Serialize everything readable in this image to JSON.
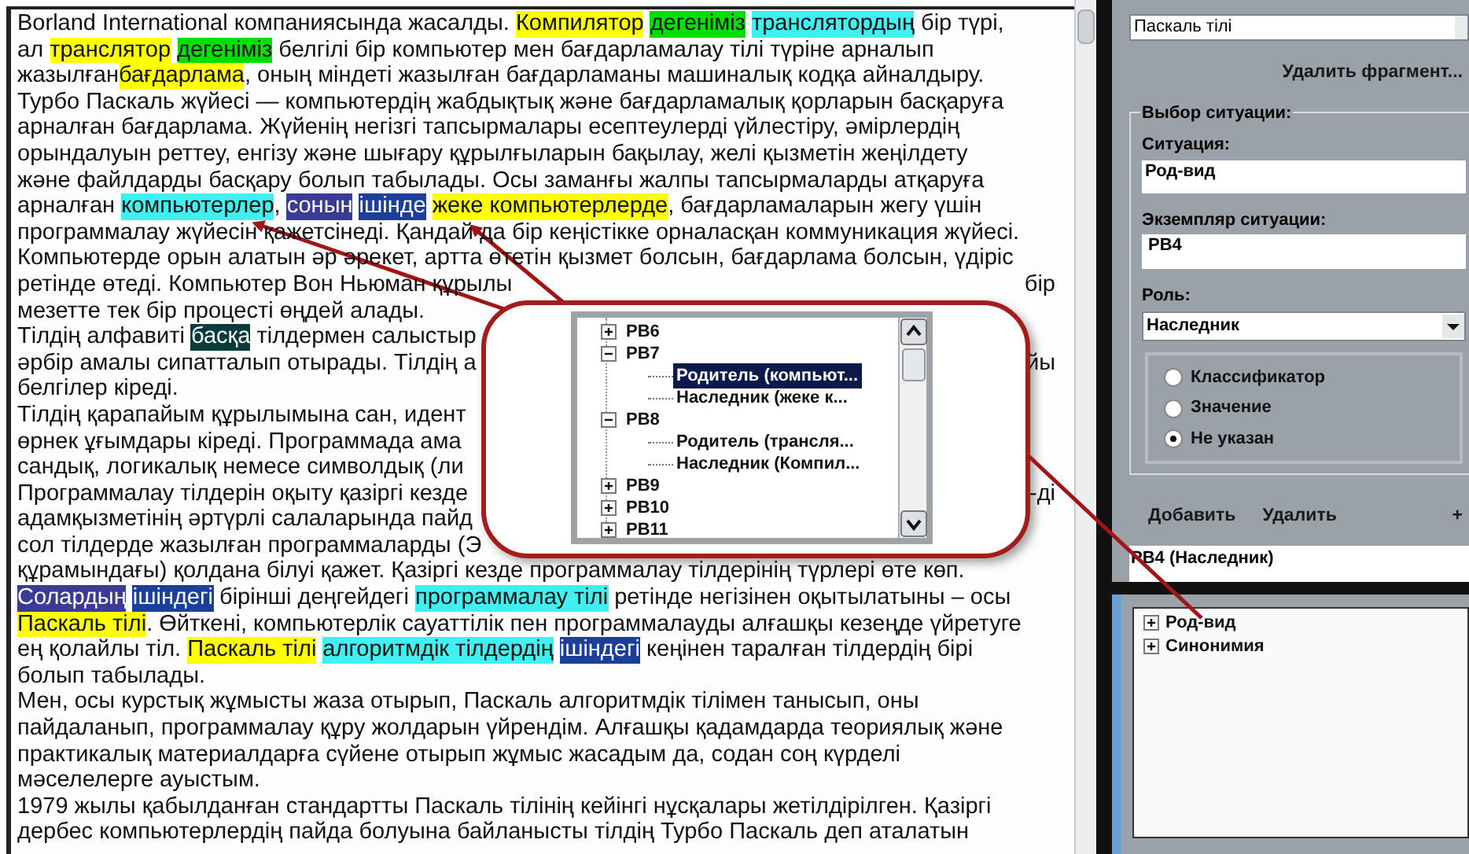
{
  "document": {
    "lines": [
      {
        "segments": [
          {
            "text": "Borland International компаниясында жасалды. "
          },
          {
            "text": "Компилятор",
            "color": "#ffff00"
          },
          {
            "text": "дегеніміз",
            "color": "#00e000"
          },
          {
            "text": "транслятордың",
            "color": "#40f0f0"
          },
          {
            "text": " бір түрі,"
          }
        ]
      },
      {
        "segments": [
          {
            "text": "ал "
          },
          {
            "text": "транслятор",
            "color": "#ffff00"
          },
          {
            "text": "дегеніміз",
            "color": "#00e000"
          },
          {
            "text": " белгілі бір компьютер мен бағдарламалау тілі түріне арналып"
          }
        ]
      },
      {
        "segments": [
          {
            "text": "жазылған"
          },
          {
            "text": "бағдарлама",
            "color": "#ffff00"
          },
          {
            "text": ", оның міндеті жазылған бағдарламаны машиналық кодқа айналдыру."
          }
        ]
      },
      {
        "segments": [
          {
            "text": "Турбо Паскаль жүйесі — компьютердің жабдықтық және бағдарламалық қорларын басқаруға"
          }
        ]
      },
      {
        "segments": [
          {
            "text": "арналған бағдарлама. Жүйенің негізгі тапсырмалары есептеулерді үйлестіру, әмірлердің"
          }
        ]
      },
      {
        "segments": [
          {
            "text": "орындалуын реттеу, енгізу және шығару құрылғыларын бақылау, желі қызметін жеңілдету"
          }
        ]
      },
      {
        "segments": [
          {
            "text": "және файлдарды басқару болып табылады. Осы заманғы жалпы тапсырмаларды атқаруға"
          }
        ]
      },
      {
        "segments": [
          {
            "text": "арналған "
          },
          {
            "text": "компьютерлер",
            "color": "#40f0f0"
          },
          {
            "text": ", "
          },
          {
            "text": "сонын",
            "color": "#3b3b96"
          },
          {
            "text": "ішінде",
            "color": "#1c3f9a"
          },
          {
            "text": "жеке компьютерлерде",
            "color": "#ffff00"
          },
          {
            "text": ", бағдарламаларын жегу үшін"
          }
        ]
      },
      {
        "segments": [
          {
            "text": "программалау жүйесін қажетсінеді. Қандай да бір кеңістікке орналасқан коммуникация жүйесі."
          }
        ]
      },
      {
        "segments": [
          {
            "text": "Компьютерде орын алатын әр әрекет, артта өтетін қызмет болсын, бағдарлама болсын, үдіріс"
          }
        ]
      },
      {
        "segments": [
          {
            "text": "ретінде өтеді. Компьютер Вон Ньюман құрылы"
          }
        ],
        "right": [
          {
            "text": "бір"
          }
        ]
      },
      {
        "segments": [
          {
            "text": "мезетте тек бір процесті өңдей алады."
          }
        ]
      },
      {
        "segments": [
          {
            "text": "Тілдің алфавиті "
          },
          {
            "text": "басқа",
            "color": "#0b3b3b"
          },
          {
            "text": " тілдермен салыстыр"
          }
        ]
      },
      {
        "segments": [
          {
            "text": "әрбір амалы сипатталып отырады. Тілдің а"
          }
        ],
        "right": [
          {
            "text": "йы"
          }
        ]
      },
      {
        "segments": [
          {
            "text": "белгілер кіреді."
          }
        ]
      },
      {
        "segments": [
          {
            "text": "Тілдің қарапайым құрылымына сан, идент"
          }
        ]
      },
      {
        "segments": [
          {
            "text": "өрнек ұғымдары кіреді. Программада ама"
          }
        ]
      },
      {
        "segments": [
          {
            "text": "сандық, логикалық немесе символдық (ли"
          }
        ]
      },
      {
        "segments": [
          {
            "text": "Программалау тілдерін оқыту қазіргі кезде"
          }
        ],
        "right": [
          {
            "text": "-ді"
          }
        ]
      },
      {
        "segments": [
          {
            "text": "адамқызметінің әртүрлі салаларында пайд"
          }
        ]
      },
      {
        "segments": [
          {
            "text": "сол тілдерде жазылған программаларды (Э"
          }
        ]
      },
      {
        "segments": [
          {
            "text": "құрамындағы) қолдана білуі қажет. Қазіргі кезде программалау тілдерінің түрлері өте көп."
          }
        ]
      },
      {
        "segments": [
          {
            "text": "Солардың",
            "color": "#3b3b96"
          },
          {
            "text": "ішіндегі",
            "color": "#1c3f9a"
          },
          {
            "text": " бірінші деңгейдегі "
          },
          {
            "text": "программалау тілі",
            "color": "#40f0f0"
          },
          {
            "text": " ретінде негізінен оқытылатыны – осы"
          }
        ]
      },
      {
        "segments": [
          {
            "text": "Паскаль тілі",
            "color": "#ffff00"
          },
          {
            "text": ". Өйткені, компьютерлік сауаттілік пен программалауды алғашқы кезеңде үйретуге"
          }
        ]
      },
      {
        "segments": [
          {
            "text": "ең қолайлы тіл. "
          },
          {
            "text": "Паскаль тілі",
            "color": "#ffff00"
          },
          {
            "text": "алгоритмдік тілдердің",
            "color": "#40f0f0"
          },
          {
            "text": "ішіндегі",
            "color": "#1c3f9a"
          },
          {
            "text": " кеңінен таралған тілдердің бірі"
          }
        ]
      },
      {
        "segments": [
          {
            "text": "болып табылады."
          }
        ]
      },
      {
        "segments": [
          {
            "text": "Мен, осы курстық жұмысты жаза отырып, Паскаль алгоритмдік тілімен танысып, оны"
          }
        ]
      },
      {
        "segments": [
          {
            "text": "пайдаланып, программалау құру жолдарын үйрендім. Алғашқы қадамдарда теориялық және"
          }
        ]
      },
      {
        "segments": [
          {
            "text": "практикалық материалдарға сүйене отырып жұмыс жасадым да, содан соң күрделі"
          }
        ]
      },
      {
        "segments": [
          {
            "text": "мәселелерге ауыстым."
          }
        ]
      },
      {
        "segments": [
          {
            "text": "1979 жылы қабылданған стандартты Паскаль тілінің кейінгі нұсқалары жетілдірілген. Қазіргі"
          }
        ]
      },
      {
        "segments": [
          {
            "text": "дербес компьютерлердің пайда болуына байланысты тілдің Турбо Паскаль деп аталатын"
          }
        ]
      }
    ]
  },
  "callout_tree": [
    {
      "label": "РВ6",
      "expanded": false,
      "selected": false
    },
    {
      "label": "РВ7",
      "expanded": true,
      "selected": false,
      "children": [
        {
          "label": "Родитель (компьют...",
          "selected": true
        },
        {
          "label": "Наследник (жеке к...",
          "selected": false
        }
      ]
    },
    {
      "label": "РВ8",
      "expanded": true,
      "selected": false,
      "children": [
        {
          "label": "Родитель (трансля...",
          "selected": false
        },
        {
          "label": "Наследник (Компил...",
          "selected": false
        }
      ]
    },
    {
      "label": "РВ9",
      "expanded": false,
      "selected": false
    },
    {
      "label": "РВ10",
      "expanded": false,
      "selected": false
    },
    {
      "label": "РВ11",
      "expanded": false,
      "selected": false
    }
  ],
  "fragment_field": {
    "value": "Паскаль тілі"
  },
  "delete_fragment_button": "Удалить фрагмент...",
  "situation_group": {
    "title": "Выбор ситуации:",
    "situation_label": "Ситуация:",
    "situation_value": "Род-вид",
    "instance_label": "Экземпляр ситуации:",
    "instance_value": "РВ4",
    "role_label": "Роль:",
    "role_value": "Наследник",
    "options": [
      {
        "label": "Классификатор",
        "selected": false
      },
      {
        "label": "Значение",
        "selected": false
      },
      {
        "label": "Не указан",
        "selected": true
      }
    ]
  },
  "toolbar": [
    "Добавить",
    "Удалить",
    "+"
  ],
  "roles_list": [
    "РВ4 (Наследник)"
  ],
  "situations_tree": [
    {
      "label": "Род-вид",
      "expanded": false
    },
    {
      "label": "Синонимия",
      "expanded": false
    }
  ]
}
